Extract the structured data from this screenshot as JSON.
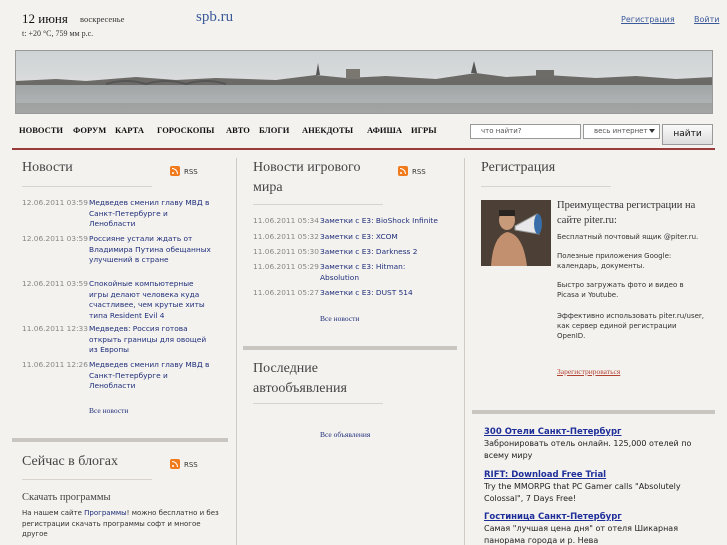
{
  "header": {
    "date": "12 июня",
    "weekday": "воскресенье",
    "weather": "t: +20 °C, 759 мм р.с.",
    "site": "spb.ru",
    "register": "Регистрация",
    "login": "Войти"
  },
  "nav": {
    "items": [
      "НОВОСТИ",
      "ФОРУМ",
      "КАРТА",
      "ГОРОСКОПЫ",
      "АВТО",
      "БЛОГИ",
      "АНЕКДОТЫ",
      "АФИША",
      "ИГРЫ"
    ],
    "search_placeholder": "что найти?",
    "search_scope": "весь интернет",
    "search_button": "найти"
  },
  "news": {
    "title": "Новости",
    "rss": "RSS",
    "items": [
      {
        "time": "12.06.2011 03:59",
        "text": "Медведев сменил главу МВД в Санкт-Петербурге и Ленобласти"
      },
      {
        "time": "12.06.2011 03:59",
        "text": "Россияне устали ждать от Владимира Путина обещанных улучшений в стране"
      },
      {
        "time": "12.06.2011 03:59",
        "text": "Спокойные компьютерные игры делают человека куда счастливее, чем крутые хиты типа Resident Evil 4"
      },
      {
        "time": "11.06.2011 12:33",
        "text": "Медведев: Россия готова открыть границы для овощей из Европы"
      },
      {
        "time": "11.06.2011 12:26",
        "text": "Медведев сменил главу МВД в Санкт-Петербурге и Ленобласти"
      }
    ],
    "all": "Все новости"
  },
  "games": {
    "title": "Новости игрового мира",
    "rss": "RSS",
    "items": [
      {
        "time": "11.06.2011 05:34",
        "text": "Заметки с E3: BioShock Infinite"
      },
      {
        "time": "11.06.2011 05:32",
        "text": "Заметки с E3: XCOM"
      },
      {
        "time": "11.06.2011 05:30",
        "text": "Заметки с E3: Darkness 2"
      },
      {
        "time": "11.06.2011 05:29",
        "text": "Заметки с E3: Hitman: Absolution"
      },
      {
        "time": "11.06.2011 05:27",
        "text": "Заметки с E3: DUST 514"
      }
    ],
    "all": "Все новости"
  },
  "autos": {
    "title": "Последние автообъявления",
    "all": "Все объявления"
  },
  "registration": {
    "title": "Регистрация",
    "benefits_title": "Преимущества регистрации на сайте piter.ru:",
    "benefits": [
      "Бесплатный почтовый ящик @piter.ru.",
      "Полезные приложения Google: календарь, документы.",
      "Быстро загружать фото и видео в Picasa и Youtube.",
      "Эффективно использовать piter.ru/user, как сервер единой регистрации OpenID."
    ],
    "submit": "Зарегистрироваться"
  },
  "ads": [
    {
      "title": "300 Отели Санкт-Петербург",
      "text": "Забронировать отель онлайн. 125,000 отелей по всему миру"
    },
    {
      "title": "RIFT: Download Free Trial",
      "text": "Try the MMORPG that PC Gamer calls \"Absolutely Colossal\", 7 Days Free!"
    },
    {
      "title": "Гостиница Санкт-Петербург",
      "text": "Самая \"лучшая цена дня\" от отеля Шикарная панорама города и р. Нева"
    }
  ],
  "blogs": {
    "title": "Сейчас в блогах",
    "rss": "RSS",
    "sub": "Скачать программы",
    "text_before": "На нашем сайте ",
    "text_link": "Программы",
    "text_after": "! можно бесплатно и без регистрации скачать программы софт и многое другое"
  },
  "colors": {
    "accent": "#9a3b3b",
    "link": "#1f2f7a",
    "rss": "#f07a1c",
    "ad_title": "#1f2f9a"
  }
}
